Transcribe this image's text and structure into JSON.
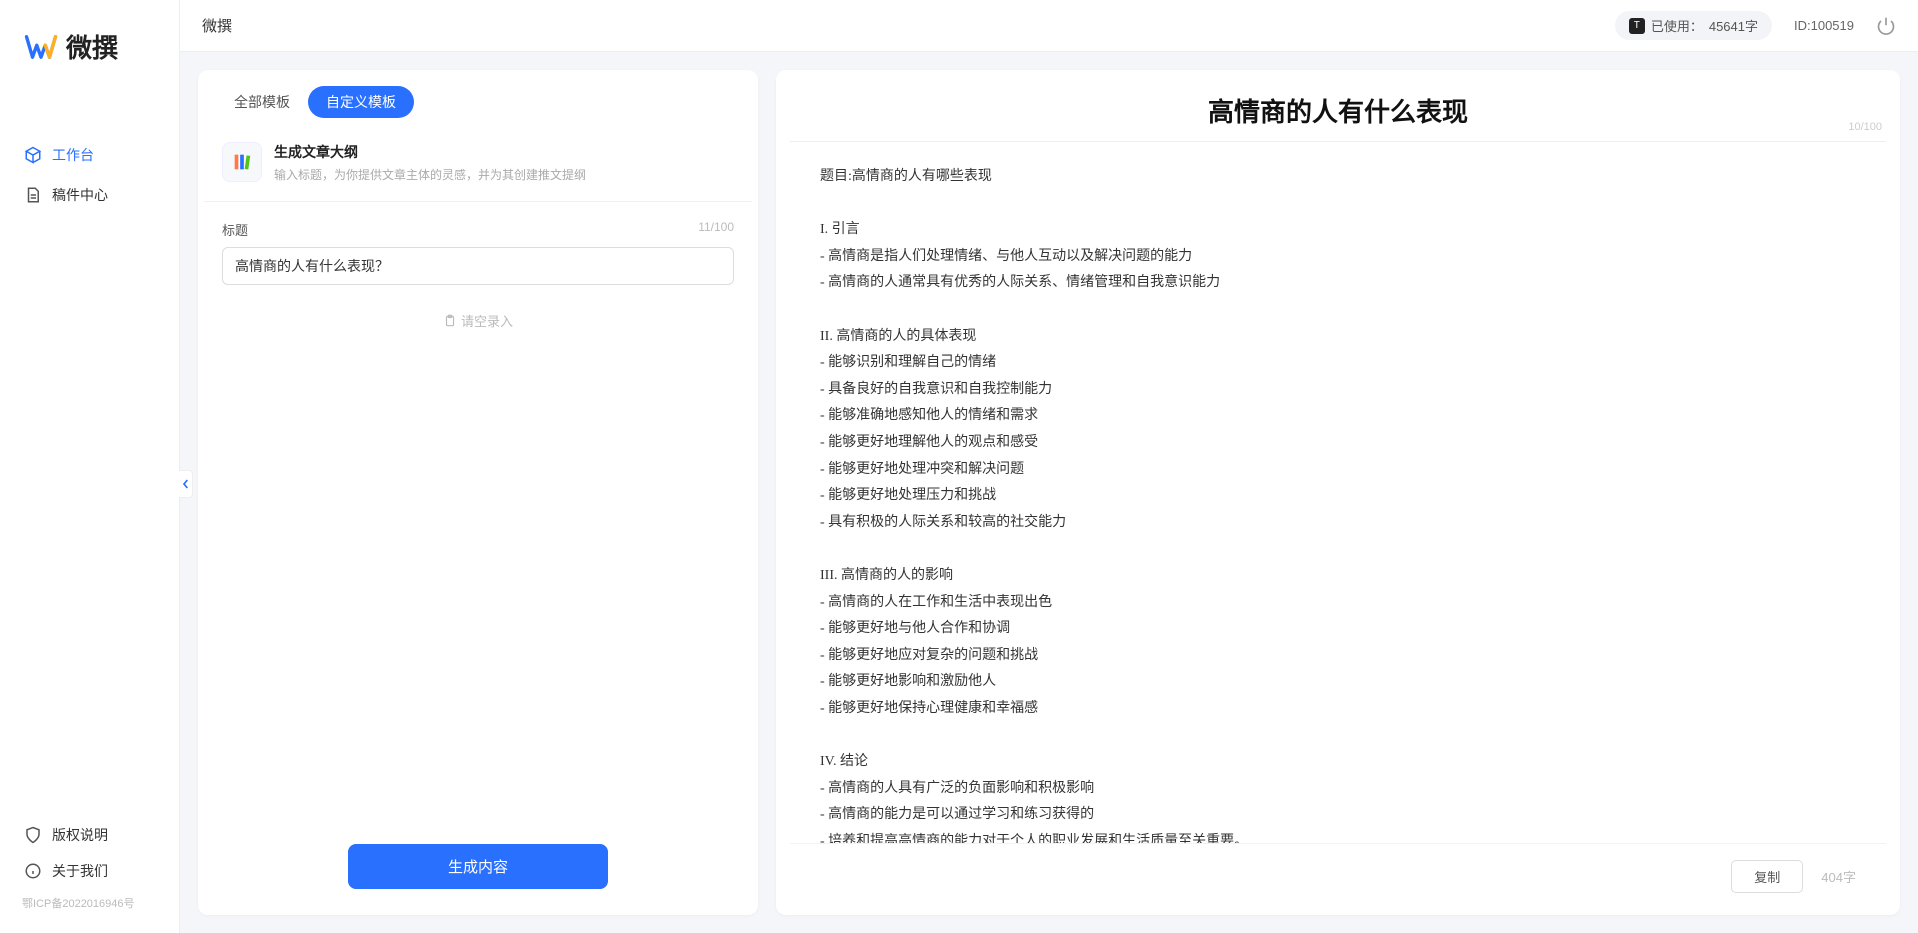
{
  "app": {
    "name": "微撰"
  },
  "topbar": {
    "usage_label": "已使用：",
    "usage_value": "45641字",
    "id_label": "ID:100519"
  },
  "sidebar": {
    "brand": "微撰",
    "nav": [
      {
        "label": "工作台",
        "active": true
      },
      {
        "label": "稿件中心",
        "active": false
      }
    ],
    "footer": [
      {
        "label": "版权说明"
      },
      {
        "label": "关于我们"
      }
    ],
    "icp": "鄂ICP备2022016946号"
  },
  "left_panel": {
    "tabs": [
      {
        "label": "全部模板",
        "active": false
      },
      {
        "label": "自定义模板",
        "active": true
      }
    ],
    "template": {
      "title": "生成文章大纲",
      "desc": "输入标题，为你提供文章主体的灵感，并为其创建推文提纲"
    },
    "form": {
      "field_label": "标题",
      "counter": "11/100",
      "value": "高情商的人有什么表现？",
      "empty_hint": "请空录入"
    },
    "generate_label": "生成内容"
  },
  "right_panel": {
    "title": "高情商的人有什么表现",
    "title_counter": "10/100",
    "body": "题目:高情商的人有哪些表现\n\nI. 引言\n- 高情商是指人们处理情绪、与他人互动以及解决问题的能力\n- 高情商的人通常具有优秀的人际关系、情绪管理和自我意识能力\n\nII. 高情商的人的具体表现\n- 能够识别和理解自己的情绪\n- 具备良好的自我意识和自我控制能力\n- 能够准确地感知他人的情绪和需求\n- 能够更好地理解他人的观点和感受\n- 能够更好地处理冲突和解决问题\n- 能够更好地处理压力和挑战\n- 具有积极的人际关系和较高的社交能力\n\nIII. 高情商的人的影响\n- 高情商的人在工作和生活中表现出色\n- 能够更好地与他人合作和协调\n- 能够更好地应对复杂的问题和挑战\n- 能够更好地影响和激励他人\n- 能够更好地保持心理健康和幸福感\n\nIV. 结论\n- 高情商的人具有广泛的负面影响和积极影响\n- 高情商的能力是可以通过学习和练习获得的\n- 培养和提高高情商的能力对于个人的职业发展和生活质量至关重要。",
    "copy_label": "复制",
    "word_count": "404字"
  }
}
